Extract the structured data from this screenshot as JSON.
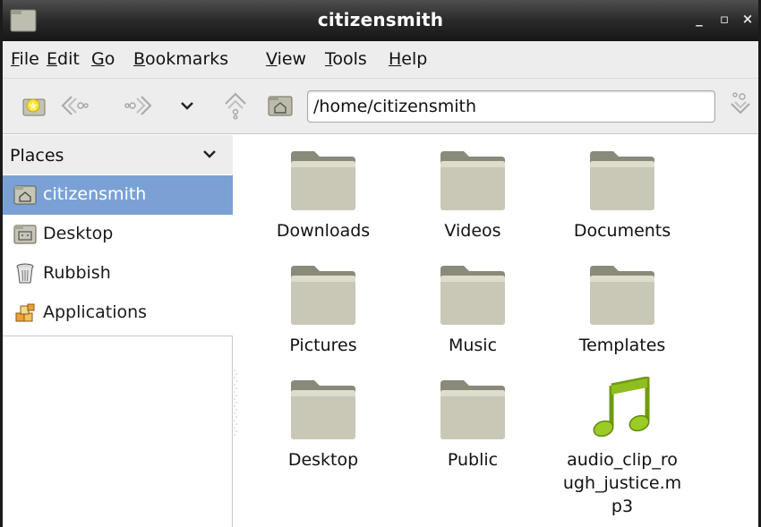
{
  "window": {
    "title": "citizensmith",
    "minimize": "_",
    "maximize": "▫",
    "close": "×"
  },
  "menu": {
    "items": [
      {
        "accel": "F",
        "rest": "ile"
      },
      {
        "accel": "E",
        "rest": "dit"
      },
      {
        "accel": "G",
        "rest": "o"
      },
      {
        "accel": "B",
        "rest": "ookmarks"
      },
      {
        "accel": "V",
        "rest": "iew"
      },
      {
        "accel": "T",
        "rest": "ools"
      },
      {
        "accel": "H",
        "rest": "elp"
      }
    ]
  },
  "toolbar": {
    "path_value": "/home/citizensmith",
    "icons": [
      "new-tab-icon",
      "back-icon",
      "forward-icon",
      "history-dropdown-icon",
      "up-icon",
      "home-icon",
      "go-icon"
    ]
  },
  "sidebar": {
    "header": "Places",
    "places": [
      {
        "label": "citizensmith",
        "icon": "home-folder-icon",
        "selected": true
      },
      {
        "label": "Desktop",
        "icon": "desktop-folder-icon",
        "selected": false
      },
      {
        "label": "Rubbish",
        "icon": "trash-icon",
        "selected": false
      },
      {
        "label": "Applications",
        "icon": "applications-icon",
        "selected": false
      }
    ]
  },
  "files": [
    {
      "name": "Downloads",
      "type": "folder"
    },
    {
      "name": "Videos",
      "type": "folder"
    },
    {
      "name": "Documents",
      "type": "folder"
    },
    {
      "name": "Pictures",
      "type": "folder"
    },
    {
      "name": "Music",
      "type": "folder"
    },
    {
      "name": "Templates",
      "type": "folder"
    },
    {
      "name": "Desktop",
      "type": "folder"
    },
    {
      "name": "Public",
      "type": "folder"
    },
    {
      "name": "audio_clip_ro ugh_justice.m p3",
      "type": "audio"
    }
  ],
  "colors": {
    "selection": "#7ba1d4",
    "folder": "#b9b8a8",
    "music": "#8fbf1e"
  }
}
